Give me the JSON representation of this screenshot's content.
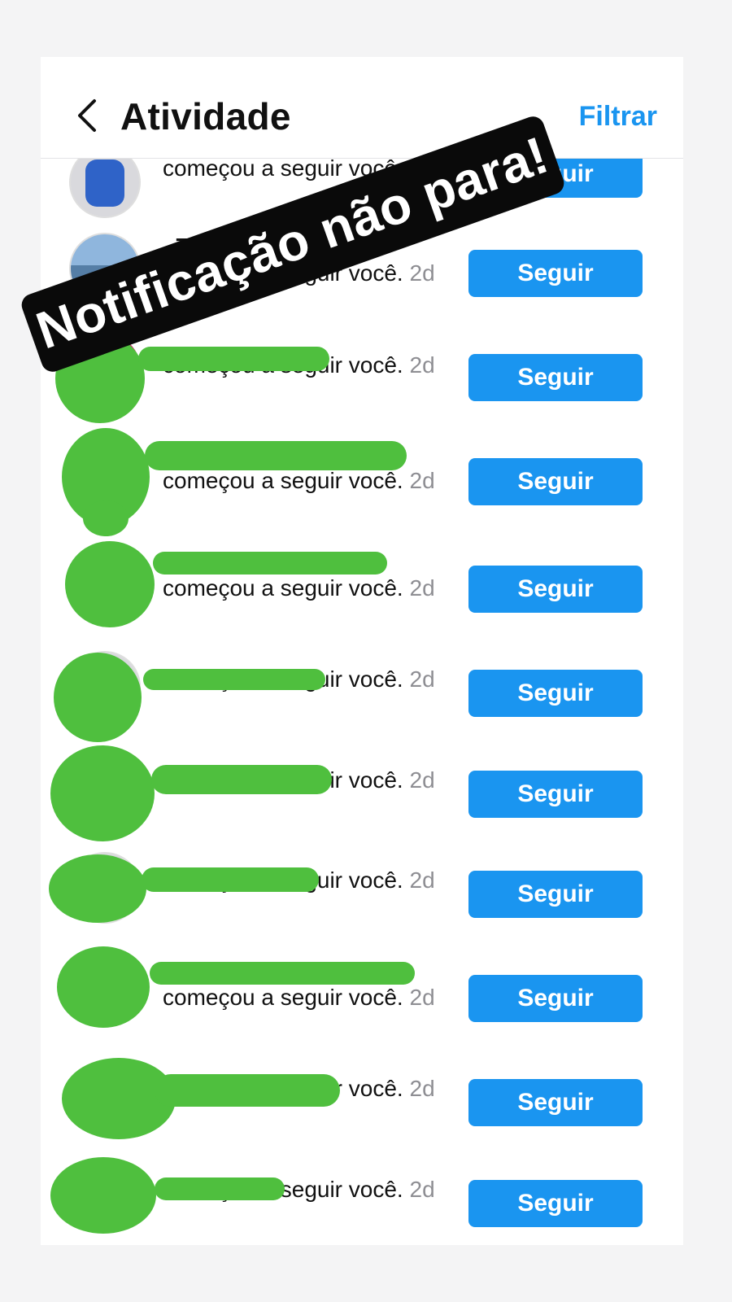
{
  "header": {
    "title": "Atividade",
    "filter_label": "Filtrar",
    "back_icon": "chevron-left-icon"
  },
  "overlay": {
    "banner_text": "Notificação não para!"
  },
  "colors": {
    "accent": "#1a95f0",
    "scribble": "#4fbf3e",
    "banner": "#0a0a0a"
  },
  "notifications": [
    {
      "user": "",
      "action": "começou a seguir você.",
      "time": "2d",
      "button": "Seguir"
    },
    {
      "user": "_748",
      "action": "começou a seguir você.",
      "time": "2d",
      "button": "Seguir"
    },
    {
      "user": "",
      "action": "começou a seguir você.",
      "time": "2d",
      "button": "Seguir"
    },
    {
      "user": "",
      "action": "começou a seguir você.",
      "time": "2d",
      "button": "Seguir"
    },
    {
      "user": "",
      "action": "começou a seguir você.",
      "time": "2d",
      "button": "Seguir"
    },
    {
      "user": "",
      "action": "começou a seguir você.",
      "time": "2d",
      "button": "Seguir"
    },
    {
      "user": "",
      "action": "começou a seguir você.",
      "time": "2d",
      "button": "Seguir"
    },
    {
      "user": "",
      "action": "começou a seguir você.",
      "time": "2d",
      "button": "Seguir"
    },
    {
      "user": "",
      "action": "começou a seguir você.",
      "time": "2d",
      "button": "Seguir"
    },
    {
      "user": "",
      "action": "começou a seguir você.",
      "time": "2d",
      "button": "Seguir"
    },
    {
      "user": "",
      "action": "começou a seguir você.",
      "time": "2d",
      "button": "Seguir"
    }
  ]
}
